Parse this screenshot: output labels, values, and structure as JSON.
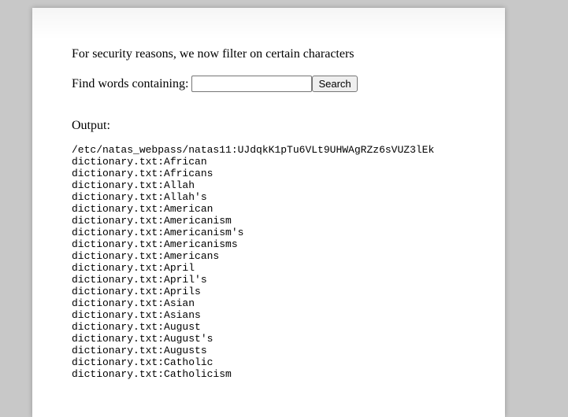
{
  "notice": "For security reasons, we now filter on certain characters",
  "search": {
    "label": "Find words containing:",
    "value": "",
    "placeholder": "",
    "button_label": "Search"
  },
  "output": {
    "label": "Output:",
    "lines": [
      "/etc/natas_webpass/natas11:UJdqkK1pTu6VLt9UHWAgRZz6sVUZ3lEk",
      "dictionary.txt:African",
      "dictionary.txt:Africans",
      "dictionary.txt:Allah",
      "dictionary.txt:Allah's",
      "dictionary.txt:American",
      "dictionary.txt:Americanism",
      "dictionary.txt:Americanism's",
      "dictionary.txt:Americanisms",
      "dictionary.txt:Americans",
      "dictionary.txt:April",
      "dictionary.txt:April's",
      "dictionary.txt:Aprils",
      "dictionary.txt:Asian",
      "dictionary.txt:Asians",
      "dictionary.txt:August",
      "dictionary.txt:August's",
      "dictionary.txt:Augusts",
      "dictionary.txt:Catholic",
      "dictionary.txt:Catholicism"
    ]
  }
}
